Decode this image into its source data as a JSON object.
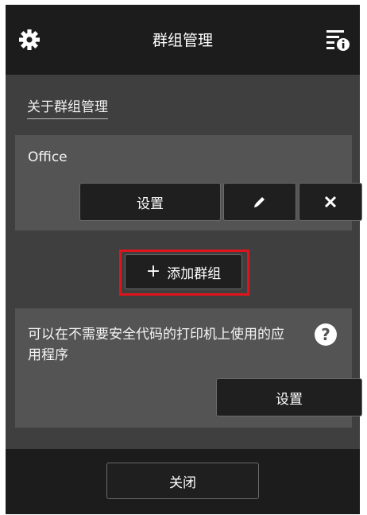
{
  "header": {
    "title": "群组管理",
    "left_icon": "gear-icon",
    "right_icon": "info-menu-icon"
  },
  "about_link": "关于群组管理",
  "group": {
    "name": "Office",
    "settings_label": "设置",
    "edit_icon": "pencil-icon",
    "delete_icon": "close-icon"
  },
  "add_group_label": "添加群组",
  "apps_section": {
    "text": "可以在不需要安全代码的打印机上使用的应用程序",
    "help_icon": "question-icon",
    "settings_label": "设置"
  },
  "footer": {
    "close_label": "关闭"
  },
  "colors": {
    "highlight": "#e0141c",
    "background": "#3f3f3f",
    "header": "#1c1c1c",
    "panel": "#545454"
  }
}
